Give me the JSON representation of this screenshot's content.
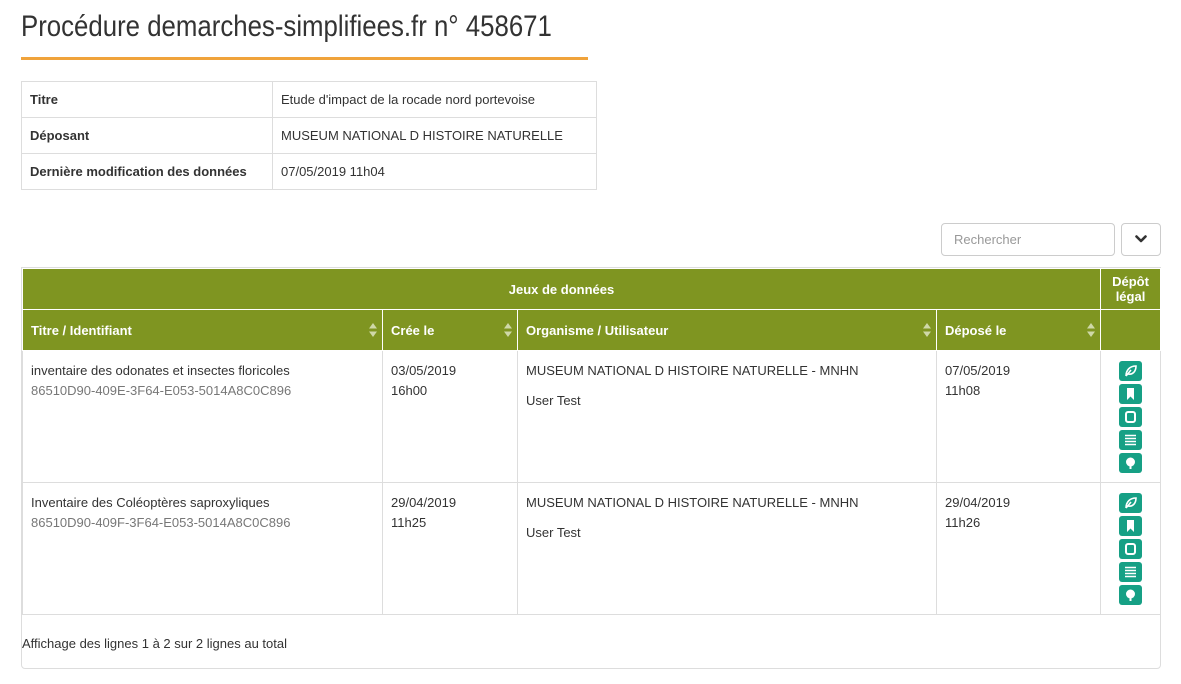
{
  "page_title": "Procédure demarches-simplifiees.fr n° 458671",
  "meta": [
    {
      "label": "Titre",
      "value": "Etude d'impact de la rocade nord portevoise"
    },
    {
      "label": "Déposant",
      "value": "MUSEUM NATIONAL D HISTOIRE NATURELLE"
    },
    {
      "label": "Dernière modification des données",
      "value": "07/05/2019 11h04"
    }
  ],
  "search": {
    "placeholder": "Rechercher"
  },
  "toolbar": {
    "toggle_icon": "chevron-down-icon"
  },
  "table": {
    "group_headers": [
      "Jeux de données",
      "Dépôt légal"
    ],
    "columns": [
      "Titre / Identifiant",
      "Crée le",
      "Organisme / Utilisateur",
      "Déposé le"
    ],
    "rows": [
      {
        "title": "inventaire des odonates et insectes floricoles",
        "identifier": "86510D90-409E-3F64-E053-5014A8C0C896",
        "created_date": "03/05/2019",
        "created_time": "16h00",
        "organism": "MUSEUM NATIONAL D HISTOIRE NATURELLE - MNHN",
        "user": "User Test",
        "deposit_date": "07/05/2019",
        "deposit_time": "11h08"
      },
      {
        "title": "Inventaire des Coléoptères saproxyliques",
        "identifier": "86510D90-409F-3F64-E053-5014A8C0C896",
        "created_date": "29/04/2019",
        "created_time": "11h25",
        "organism": "MUSEUM NATIONAL D HISTOIRE NATURELLE - MNHN",
        "user": "User Test",
        "deposit_date": "29/04/2019",
        "deposit_time": "11h26"
      }
    ],
    "row_actions": [
      "leaf-icon",
      "bookmark-icon",
      "square-icon",
      "list-icon",
      "tree-icon"
    ],
    "footer": "Affichage des lignes 1 à 2 sur 2 lignes au total"
  },
  "colors": {
    "header_bg": "#7f9521",
    "action_bg": "#16a085",
    "title_underline": "#f0a33b"
  }
}
